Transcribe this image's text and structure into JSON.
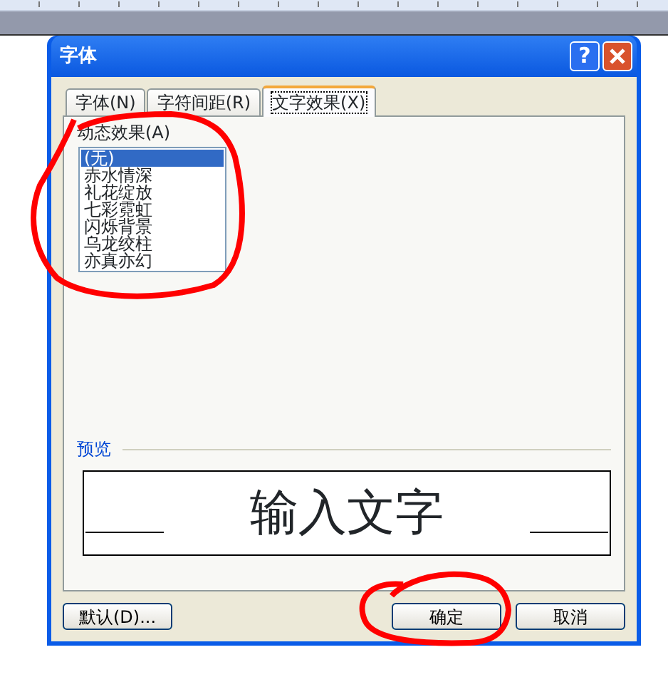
{
  "dialog": {
    "title": "字体",
    "help_button": "?",
    "tabs": [
      {
        "label": "字体(N)",
        "selected": false
      },
      {
        "label": "字符间距(R)",
        "selected": false
      },
      {
        "label": "文字效果(X)",
        "selected": true
      }
    ],
    "effects_label": "动态效果(A)",
    "effects": [
      {
        "label": "(无)",
        "selected": true
      },
      {
        "label": "赤水情深",
        "selected": false
      },
      {
        "label": "礼花绽放",
        "selected": false
      },
      {
        "label": "七彩霓虹",
        "selected": false
      },
      {
        "label": "闪烁背景",
        "selected": false
      },
      {
        "label": "乌龙绞柱",
        "selected": false
      },
      {
        "label": "亦真亦幻",
        "selected": false
      }
    ],
    "preview_label": "预览",
    "preview_text": "输入文字",
    "buttons": [
      {
        "label": "默认(D)...",
        "kind": "left"
      },
      {
        "label": "确定",
        "kind": "right"
      },
      {
        "label": "取消",
        "kind": "right"
      }
    ]
  }
}
